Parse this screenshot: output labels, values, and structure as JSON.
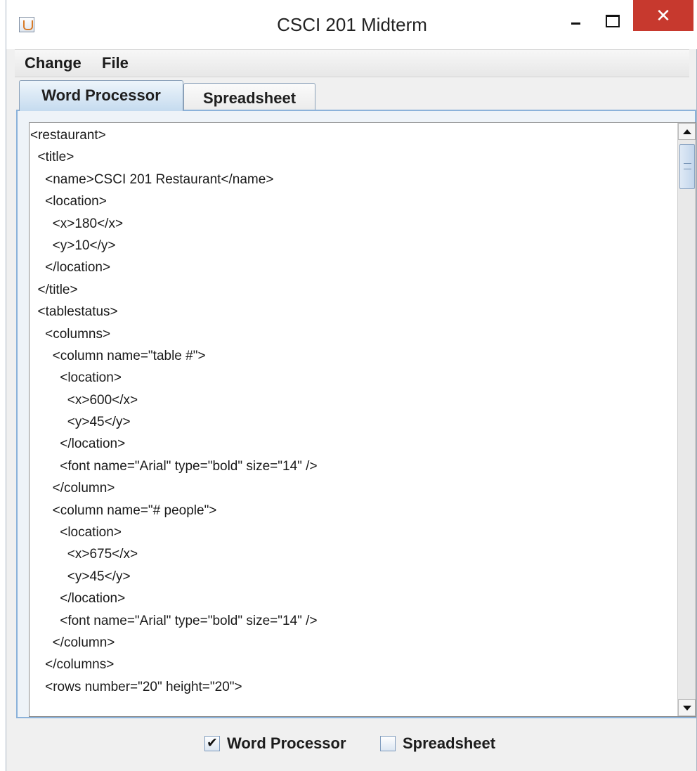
{
  "window": {
    "title": "CSCI 201 Midterm",
    "close_glyph": "✕"
  },
  "menu": {
    "items": [
      "Change",
      "File"
    ]
  },
  "tabs": [
    {
      "label": "Word Processor",
      "active": true
    },
    {
      "label": "Spreadsheet",
      "active": false
    }
  ],
  "editor": {
    "lines": [
      "<restaurant>",
      "  <title>",
      "    <name>CSCI 201 Restaurant</name>",
      "    <location>",
      "      <x>180</x>",
      "      <y>10</y>",
      "    </location>",
      "  </title>",
      "  <tablestatus>",
      "    <columns>",
      "      <column name=\"table #\">",
      "        <location>",
      "          <x>600</x>",
      "          <y>45</y>",
      "        </location>",
      "        <font name=\"Arial\" type=\"bold\" size=\"14\" />",
      "      </column>",
      "      <column name=\"# people\">",
      "        <location>",
      "          <x>675</x>",
      "          <y>45</y>",
      "        </location>",
      "        <font name=\"Arial\" type=\"bold\" size=\"14\" />",
      "      </column>",
      "    </columns>",
      "    <rows number=\"20\" height=\"20\">"
    ]
  },
  "bottom": {
    "word_processor": {
      "label": "Word Processor",
      "checked": true,
      "check_glyph": "✔"
    },
    "spreadsheet": {
      "label": "Spreadsheet",
      "checked": false
    }
  }
}
